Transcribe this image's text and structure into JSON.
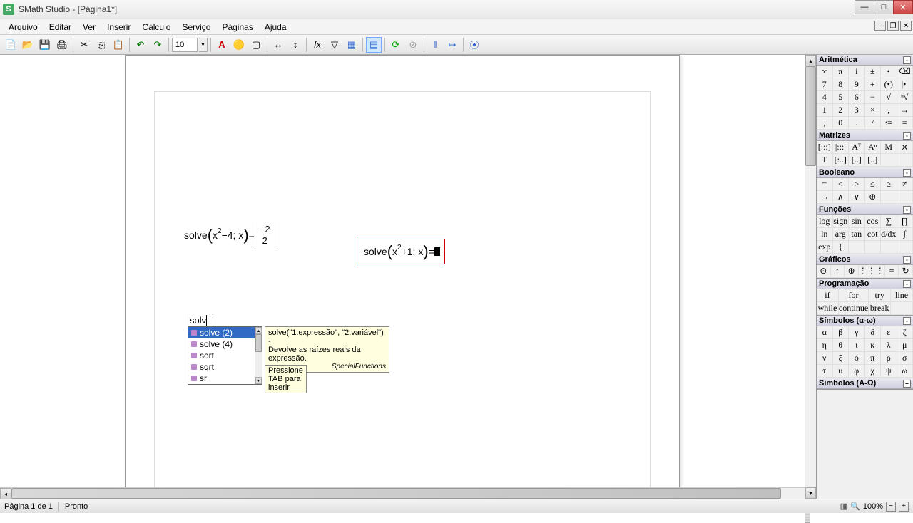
{
  "window": {
    "app_icon": "S",
    "title": "SMath Studio - [Página1*]"
  },
  "menu": [
    "Arquivo",
    "Editar",
    "Ver",
    "Inserir",
    "Cálculo",
    "Serviço",
    "Páginas",
    "Ajuda"
  ],
  "toolbar": {
    "font_size": "10"
  },
  "equations": {
    "eq1": {
      "fn": "solve",
      "arg": "x",
      "exp": "2",
      "tail": "−4; x",
      "eq": "=",
      "mat_top": "−2",
      "mat_bot": "2"
    },
    "eq2": {
      "fn": "solve",
      "arg": "x",
      "exp": "2",
      "tail": "+1; x",
      "eq": "="
    }
  },
  "autocomplete": {
    "typed": "solv",
    "items": [
      {
        "label": "solve (2)",
        "selected": true
      },
      {
        "label": "solve (4)",
        "selected": false
      },
      {
        "label": "sort",
        "selected": false
      },
      {
        "label": "sqrt",
        "selected": false
      },
      {
        "label": "sr",
        "selected": false
      }
    ],
    "tooltip_sig": "solve(\"1:expressão\", \"2:variável\") -",
    "tooltip_desc": "Devolve as raízes reais da expressão.",
    "tooltip_src": "SpecialFunctions",
    "tab_hint": "Pressione TAB para inserir"
  },
  "panels": {
    "arith": {
      "title": "Aritmética",
      "rows": [
        [
          "∞",
          "π",
          "i",
          "±",
          "•",
          "⌫"
        ],
        [
          "7",
          "8",
          "9",
          "+",
          "(•)",
          "|•|"
        ],
        [
          "4",
          "5",
          "6",
          "−",
          "√",
          "ⁿ√"
        ],
        [
          "1",
          "2",
          "3",
          "×",
          ",",
          "→"
        ],
        [
          ",",
          "0",
          ".",
          "/",
          ":=",
          "="
        ]
      ]
    },
    "matrix": {
      "title": "Matrizes",
      "rows": [
        [
          "[:::]",
          "|:::|",
          "Aᵀ",
          "Aⁿ",
          "M",
          "⨯"
        ],
        [
          "T",
          "[:..]",
          "[..]",
          "[..]",
          "",
          ""
        ]
      ]
    },
    "bool": {
      "title": "Booleano",
      "rows": [
        [
          "=",
          "<",
          ">",
          "≤",
          "≥",
          "≠"
        ],
        [
          "¬",
          "∧",
          "∨",
          "⊕",
          "",
          ""
        ]
      ]
    },
    "func": {
      "title": "Funções",
      "rows": [
        [
          "log",
          "sign",
          "sin",
          "cos",
          "∑",
          "∏"
        ],
        [
          "ln",
          "arg",
          "tan",
          "cot",
          "d/dx",
          "∫"
        ],
        [
          "exp",
          "{",
          "",
          "",
          "",
          ""
        ]
      ]
    },
    "plot": {
      "title": "Gráficos",
      "rows": [
        [
          "⊙",
          "↑",
          "⊕",
          "⋮⋮⋮",
          "≡",
          "↻"
        ]
      ]
    },
    "prog": {
      "title": "Programação",
      "rows": [
        [
          "if",
          "for",
          "try",
          "line"
        ],
        [
          "while",
          "continue",
          "break",
          ""
        ]
      ]
    },
    "greek": {
      "title": "Símbolos (α-ω)",
      "rows": [
        [
          "α",
          "β",
          "γ",
          "δ",
          "ε",
          "ζ"
        ],
        [
          "η",
          "θ",
          "ι",
          "κ",
          "λ",
          "μ"
        ],
        [
          "ν",
          "ξ",
          "ο",
          "π",
          "ρ",
          "σ"
        ],
        [
          "τ",
          "υ",
          "φ",
          "χ",
          "ψ",
          "ω"
        ]
      ]
    },
    "greekUpper": {
      "title": "Símbolos (A-Ω)"
    }
  },
  "status": {
    "page": "Página 1 de 1",
    "state": "Pronto",
    "zoom": "100%"
  }
}
